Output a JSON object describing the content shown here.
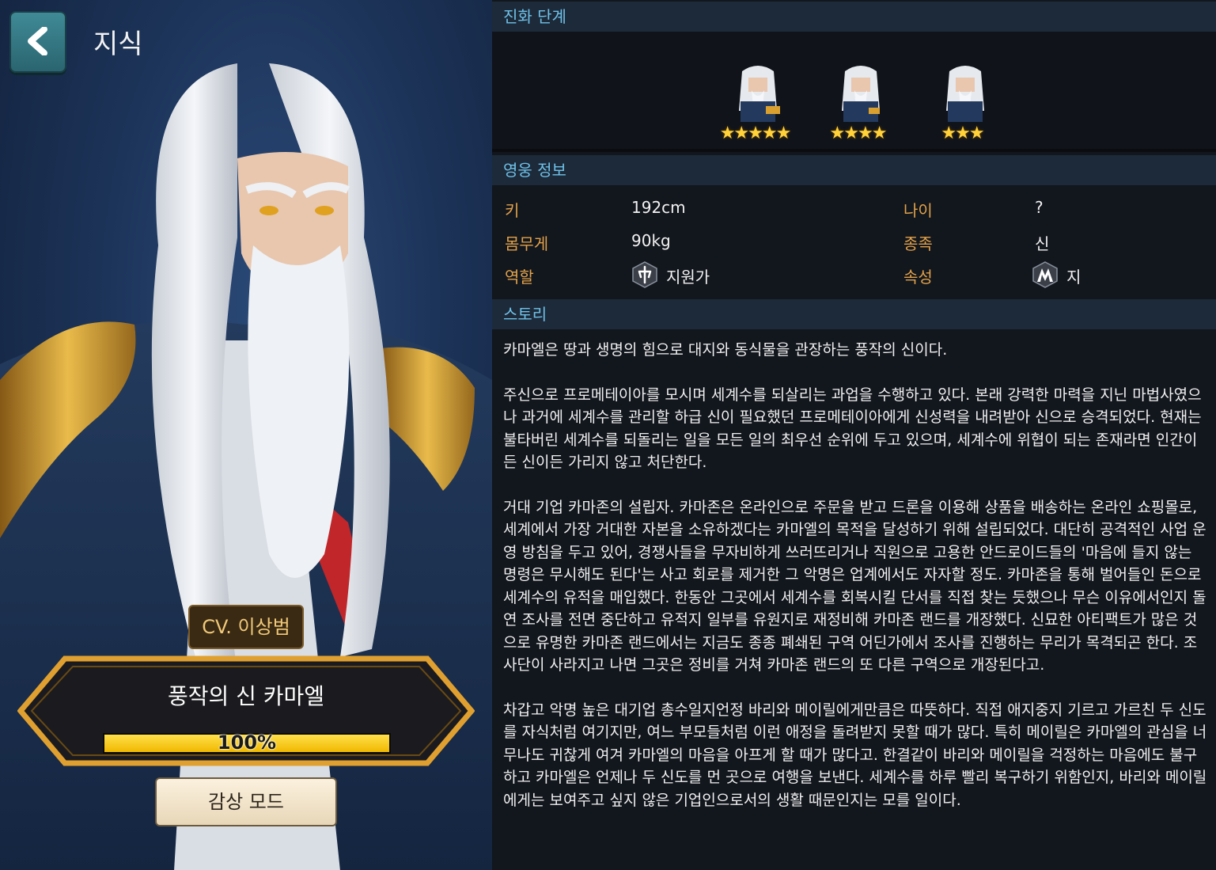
{
  "header": {
    "title": "지식",
    "back_icon": "chevron-left-icon"
  },
  "hero": {
    "cv": "CV. 이상범",
    "name": "풍작의 신 카마엘",
    "progress_text": "100%",
    "progress_fraction": 1.0,
    "view_mode_label": "감상 모드"
  },
  "evolution": {
    "heading": "진화 단계",
    "stages": [
      {
        "stars": "★★★★★"
      },
      {
        "stars": "★★★★"
      },
      {
        "stars": "★★★"
      }
    ]
  },
  "info": {
    "heading": "영웅 정보",
    "height_label": "키",
    "height_value": "192cm",
    "age_label": "나이",
    "age_value": "?",
    "weight_label": "몸무게",
    "weight_value": "90kg",
    "race_label": "종족",
    "race_value": "신",
    "role_label": "역할",
    "role_value": "지원가",
    "role_icon": "support-role-icon",
    "attr_label": "속성",
    "attr_value": "지",
    "attr_icon": "earth-attribute-icon"
  },
  "story": {
    "heading": "스토리",
    "paragraphs": [
      "카마엘은 땅과 생명의 힘으로 대지와 동식물을 관장하는 풍작의 신이다.",
      "주신으로 프로메테이아를 모시며 세계수를 되살리는 과업을 수행하고 있다. 본래 강력한 마력을 지닌 마법사였으나 과거에 세계수를 관리할 하급 신이 필요했던 프로메테이아에게 신성력을 내려받아 신으로 승격되었다. 현재는 불타버린 세계수를 되돌리는 일을 모든 일의 최우선 순위에 두고 있으며, 세계수에 위협이 되는 존재라면 인간이든 신이든 가리지 않고 처단한다.",
      "거대 기업 카마존의 설립자. 카마존은 온라인으로 주문을 받고 드론을 이용해 상품을 배송하는 온라인 쇼핑몰로, 세계에서 가장 거대한 자본을 소유하겠다는 카마엘의 목적을 달성하기 위해 설립되었다. 대단히 공격적인 사업 운영 방침을 두고 있어, 경쟁사들을 무자비하게 쓰러뜨리거나 직원으로 고용한 안드로이드들의 '마음에 들지 않는 명령은 무시해도 된다'는 사고 회로를 제거한 그 악명은 업계에서도 자자할 정도. 카마존을 통해 벌어들인 돈으로 세계수의 유적을 매입했다. 한동안 그곳에서 세계수를 회복시킬 단서를 직접 찾는 듯했으나 무슨 이유에서인지 돌연 조사를 전면 중단하고 유적지 일부를 유원지로 재정비해 카마존 랜드를 개장했다. 신묘한 아티팩트가 많은 것으로 유명한 카마존 랜드에서는 지금도 종종 폐쇄된 구역 어딘가에서 조사를 진행하는 무리가 목격되곤 한다. 조사단이 사라지고 나면 그곳은 정비를 거쳐 카마존 랜드의 또 다른 구역으로 개장된다고.",
      "차갑고 악명 높은 대기업 총수일지언정 바리와 메이릴에게만큼은 따뜻하다. 직접 애지중지 기르고 가르친 두 신도를 자식처럼 여기지만, 여느 부모들처럼 이런 애정을 돌려받지 못할 때가 많다. 특히 메이릴은 카마엘의 관심을 너무나도 귀찮게 여겨 카마엘의 마음을 아프게 할 때가 많다고. 한결같이 바리와 메이릴을 걱정하는 마음에도 불구하고 카마엘은 언제나 두 신도를 먼 곳으로 여행을 보낸다. 세계수를 하루 빨리 복구하기 위함인지, 바리와 메이릴에게는 보여주고 싶지 않은 기업인으로서의 생활 때문인지는 모를 일이다."
    ]
  },
  "colors": {
    "section_header_text": "#6fc1e8",
    "label": "#e2a24a",
    "progress": "#f5c400",
    "accent_teal": "#3f8a96"
  }
}
